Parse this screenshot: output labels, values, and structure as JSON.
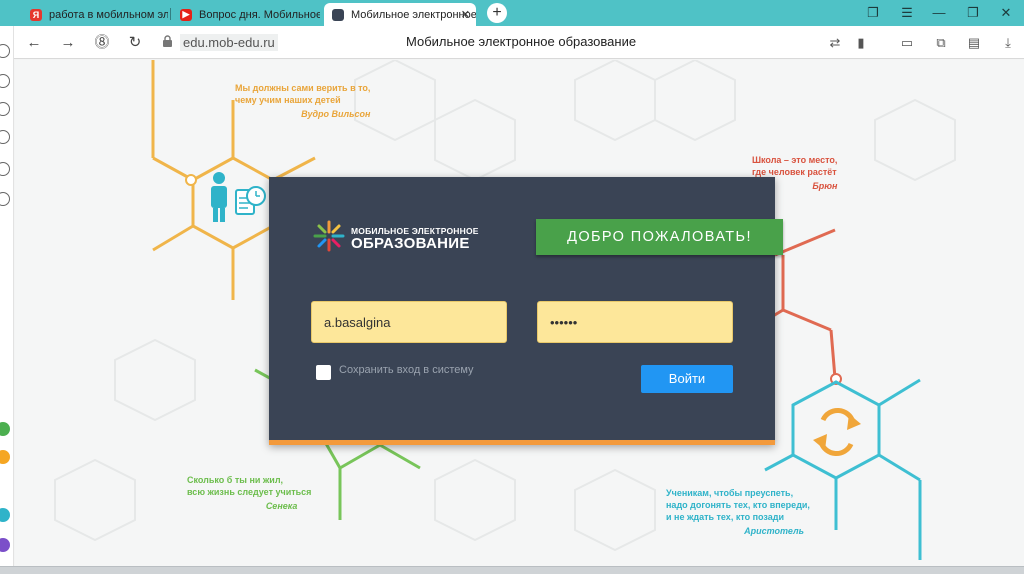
{
  "browser": {
    "tabs": [
      {
        "title": "работа в мобильном элек",
        "icon": "yandex-icon",
        "active": false
      },
      {
        "title": "Вопрос дня. Мобильное э",
        "icon": "youtube-icon",
        "active": false
      },
      {
        "title": "Мобильное электронное",
        "icon": "mob-edu-icon",
        "active": true,
        "close": "✕"
      }
    ],
    "new_tab": "+",
    "address": "edu.mob-edu.ru",
    "page_title": "Мобильное электронное образование"
  },
  "page": {
    "quotes": [
      {
        "text_line1": "Мы должны сами верить в то,",
        "text_line2": "чему учим наших детей",
        "author": "Вудро Вильсон",
        "color": "#e9a53a"
      },
      {
        "text_line1": "Школа – это место,",
        "text_line2": "где человек растёт",
        "author": "Брюн",
        "color": "#d9533f"
      },
      {
        "text_line1": "Сколько б ты ни жил,",
        "text_line2": "всю жизнь следует учиться",
        "author": "Сенека",
        "color": "#6cbd4c"
      },
      {
        "text_line1": "Ученикам, чтобы преуспеть,",
        "text_line2": "надо догонять тех, кто впереди,",
        "text_line3": "и не ждать тех, кто позади",
        "author": "Аристотель",
        "color": "#2fb3c9"
      }
    ]
  },
  "login": {
    "logo_line1": "МОБИЛЬНОЕ ЭЛЕКТРОННОЕ",
    "logo_line2": "ОБРАЗОВАНИЕ",
    "welcome": "ДОБРО ПОЖАЛОВАТЬ!",
    "login_value": "a.basalgina",
    "password_value": "••••••",
    "remember_label": "Сохранить вход в систему",
    "remember_checked": false,
    "submit_label": "Войти"
  },
  "colors": {
    "tabbar": "#4fc2c6",
    "card": "#3a4455",
    "welcome": "#49a14a",
    "field": "#fde79a",
    "button": "#2196f3",
    "accent_bar": "#f39a3c"
  }
}
